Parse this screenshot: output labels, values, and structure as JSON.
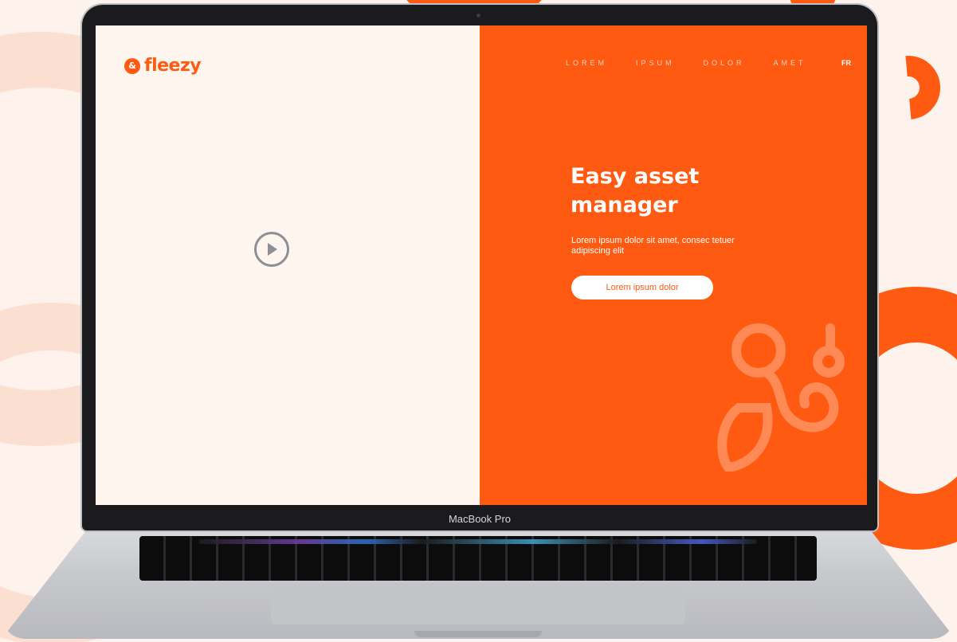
{
  "device": {
    "brand_label": "MacBook Pro"
  },
  "logo": {
    "mark": "&",
    "name": "fleezy"
  },
  "nav": {
    "items": [
      {
        "label": "LOREM"
      },
      {
        "label": "IPSUM"
      },
      {
        "label": "DOLOR"
      },
      {
        "label": "AMET"
      }
    ],
    "language": "FR"
  },
  "hero": {
    "title": "Easy asset manager",
    "subtitle": "Lorem ipsum dolor sit amet, consec tetuer adipiscing elit",
    "cta_label": "Lorem ipsum dolor"
  },
  "icons": {
    "play": "play-icon",
    "watermark": "fleezy-logo-watermark"
  },
  "colors": {
    "brand_orange": "#ff5a12",
    "cream": "#fff5ef",
    "background": "#fdf2ec",
    "play_grey": "#8e8f94"
  }
}
